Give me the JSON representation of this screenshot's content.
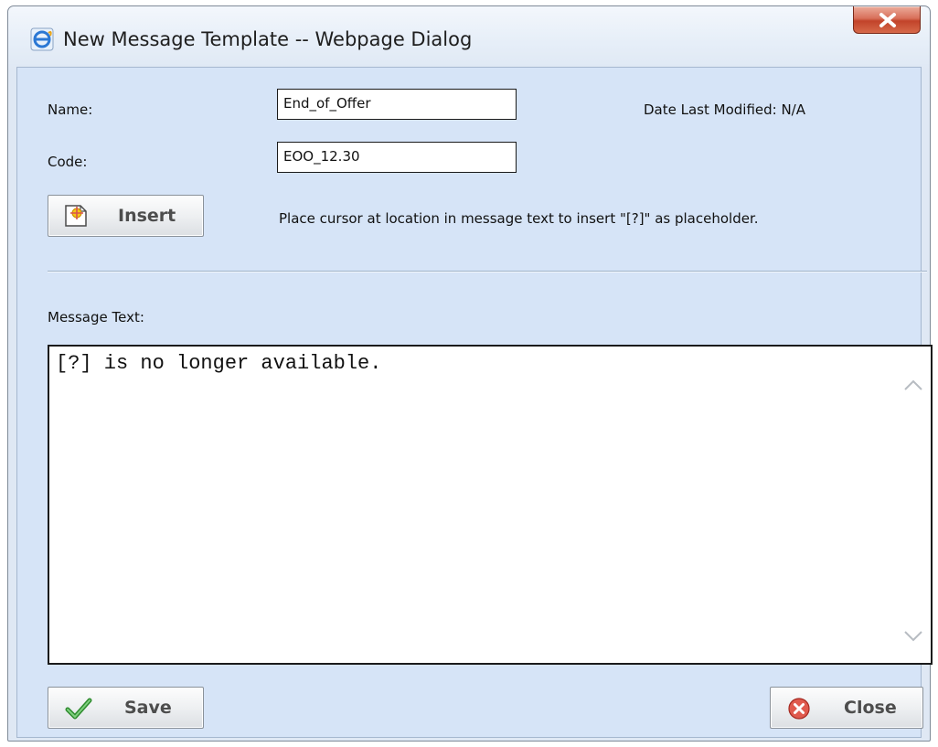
{
  "window": {
    "title": "New Message Template -- Webpage Dialog"
  },
  "form": {
    "name_label": "Name:",
    "name_value": "End_of_Offer",
    "date_modified": "Date Last Modified: N/A",
    "code_label": "Code:",
    "code_value": "EOO_12.30",
    "insert_label": "Insert",
    "insert_hint": "Place cursor at location in message text to insert \"[?]\" as placeholder.",
    "message_label": "Message Text:",
    "message_value": "[?] is no longer available."
  },
  "footer": {
    "save_label": "Save",
    "close_label": "Close"
  },
  "icons": {
    "title": "ie-icon",
    "close_window": "close-icon",
    "insert": "insert-placeholder-icon",
    "save": "checkmark-icon",
    "close": "close-circle-icon"
  },
  "colors": {
    "client_bg": "#d6e4f7",
    "close_button": "#c2432a"
  }
}
